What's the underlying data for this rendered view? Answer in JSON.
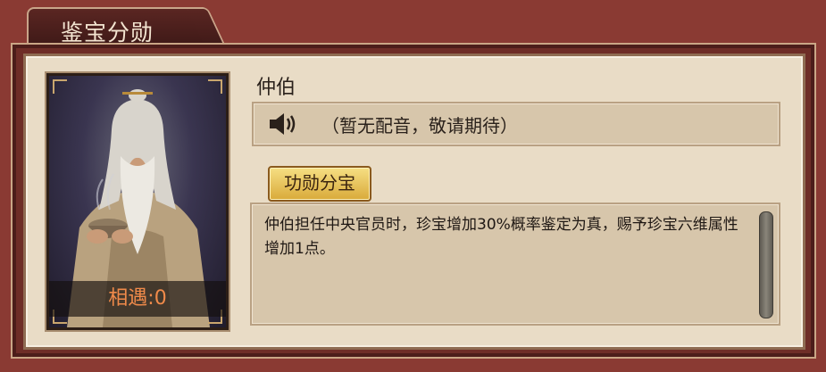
{
  "window": {
    "title": "鉴宝分勋"
  },
  "portrait": {
    "encounter_label": "相遇:0"
  },
  "character": {
    "name": "仲伯"
  },
  "voice": {
    "text": "（暂无配音，敬请期待）"
  },
  "skill": {
    "button_label": "功勋分宝"
  },
  "description": {
    "text": "仲伯担任中央官员时，珍宝增加30%概率鉴定为真，赐予珍宝六维属性增加1点。"
  },
  "icons": {
    "voice": "speaker-icon"
  },
  "colors": {
    "accent": "#f08a4a",
    "gold": "#d9aa3a",
    "frame": "#8a3a33"
  }
}
